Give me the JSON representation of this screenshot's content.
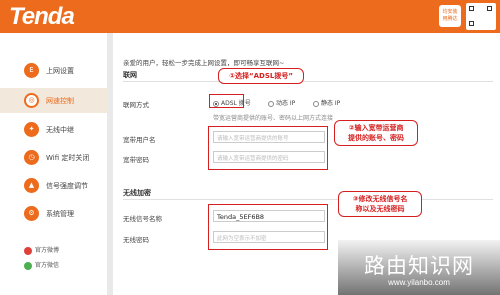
{
  "header": {
    "brand": "Tenda",
    "badge_line1": "均安装",
    "badge_line2": "用腾达"
  },
  "sidebar": {
    "items": [
      {
        "icon": "E",
        "label": "上网设置"
      },
      {
        "icon": "◎",
        "label": "网速控制"
      },
      {
        "icon": "✦",
        "label": "无线中继"
      },
      {
        "icon": "◷",
        "label": "Wifi 定时关闭"
      },
      {
        "icon": "▲",
        "label": "信号强度调节"
      },
      {
        "icon": "⚙",
        "label": "系统管理"
      }
    ],
    "social": [
      {
        "label": "官方微博",
        "color": "#e0403a"
      },
      {
        "label": "官方微信",
        "color": "#4caf50"
      }
    ]
  },
  "main": {
    "intro": "亲爱的用户，轻松一步完成上网设置，即可畅享互联网~",
    "net_section": "联网",
    "mode_label": "联网方式",
    "modes": [
      "ADSL 拨号",
      "动态 IP",
      "静态 IP"
    ],
    "mode_hint": "带宽运营商提供的账号、密码以上网方式连接",
    "user_label": "宽带用户名",
    "user_placeholder": "请输入宽带运营商提供的账号",
    "pass_label": "宽带密码",
    "pass_placeholder": "请输入宽带运营商提供的密码",
    "wifi_section": "无线加密",
    "ssid_label": "无线信号名称",
    "ssid_value": "Tenda_5EF6B8",
    "wpass_label": "无线密码",
    "wpass_placeholder": "此网为空表示不加密"
  },
  "annotations": {
    "c1": "①选择“ADSL拨号”",
    "c2a": "②输入宽带运营商",
    "c2b": "提供的账号、密码",
    "c3a": "③修改无线信号名",
    "c3b": "称以及无线密码"
  },
  "watermark": {
    "title": "路由知识网",
    "url": "www.yilanbo.com"
  },
  "colors": {
    "brand": "#ec6b1d",
    "annotation": "#d62020"
  }
}
